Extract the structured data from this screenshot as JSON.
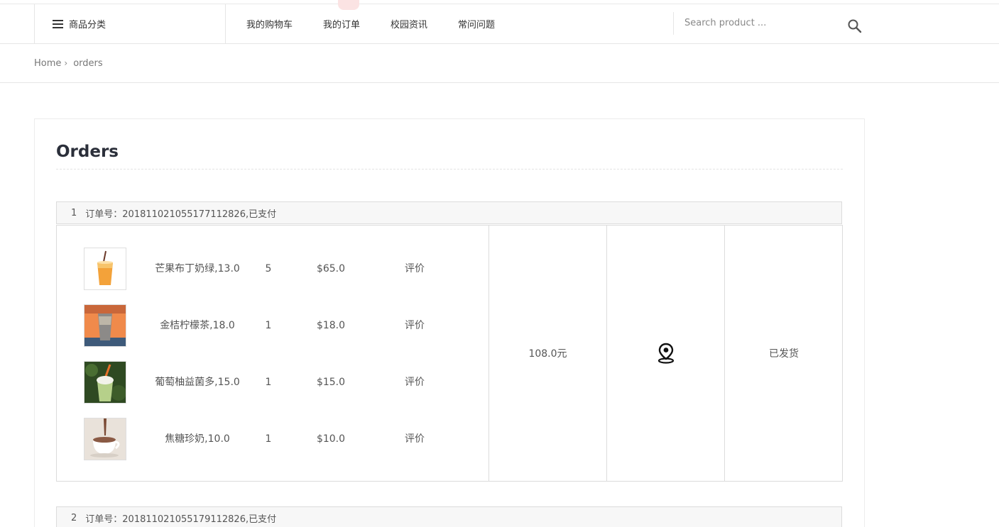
{
  "nav": {
    "category_label": "商品分类",
    "links": [
      "我的购物车",
      "我的订单",
      "校园资讯",
      "常问问题"
    ],
    "search_placeholder": "Search product ..."
  },
  "breadcrumb": {
    "home": "Home",
    "separator": "›",
    "current": "orders"
  },
  "page": {
    "title": "Orders"
  },
  "orders": [
    {
      "index": "1",
      "header": "订单号：2018110210551771128​26,已支付",
      "total": "108.0元",
      "status": "已发货",
      "items": [
        {
          "name": "芒果布丁奶绿,13.0",
          "qty": "5",
          "price": "$65.0",
          "review": "评价",
          "image": "iced-drink-image"
        },
        {
          "name": "金桔柠檬茶,18.0",
          "qty": "1",
          "price": "$18.0",
          "review": "评价",
          "image": "lemon-tea-image"
        },
        {
          "name": "葡萄柚益菌多,15.0",
          "qty": "1",
          "price": "$15.0",
          "review": "评价",
          "image": "green-drink-image"
        },
        {
          "name": "焦糖珍奶,10.0",
          "qty": "1",
          "price": "$10.0",
          "review": "评价",
          "image": "hot-milk-tea-image"
        }
      ]
    },
    {
      "index": "2",
      "header": "订单号：20181102105517911282​6,已支付"
    }
  ],
  "icons": {
    "menu": "hamburger-icon",
    "search": "search-icon",
    "location": "map-pin-icon"
  },
  "colors": {
    "title": "#2b2f3a",
    "border": "#dcdcdc",
    "header_bg": "#f7f7f7"
  }
}
